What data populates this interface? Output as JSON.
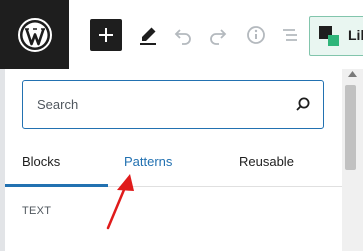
{
  "toolbar": {
    "logo": "wordpress-logo-icon",
    "tools": [
      "add-block-icon",
      "edit-pencil-icon",
      "undo-icon",
      "redo-icon",
      "info-icon",
      "list-view-icon"
    ],
    "library_button_label": "Lib"
  },
  "inserter": {
    "search": {
      "placeholder": "Search",
      "value": ""
    },
    "tabs": [
      {
        "label": "Blocks",
        "selected": true
      },
      {
        "label": "Patterns",
        "selected": false
      },
      {
        "label": "Reusable",
        "selected": false
      }
    ],
    "section_heading": "TEXT"
  },
  "colors": {
    "accent": "#2271b1",
    "toolbar_dark": "#1e1e1e",
    "annotation_arrow": "#e01b1b",
    "library_button_bg": "#e9f6f1",
    "library_button_border": "#82c5ac"
  }
}
